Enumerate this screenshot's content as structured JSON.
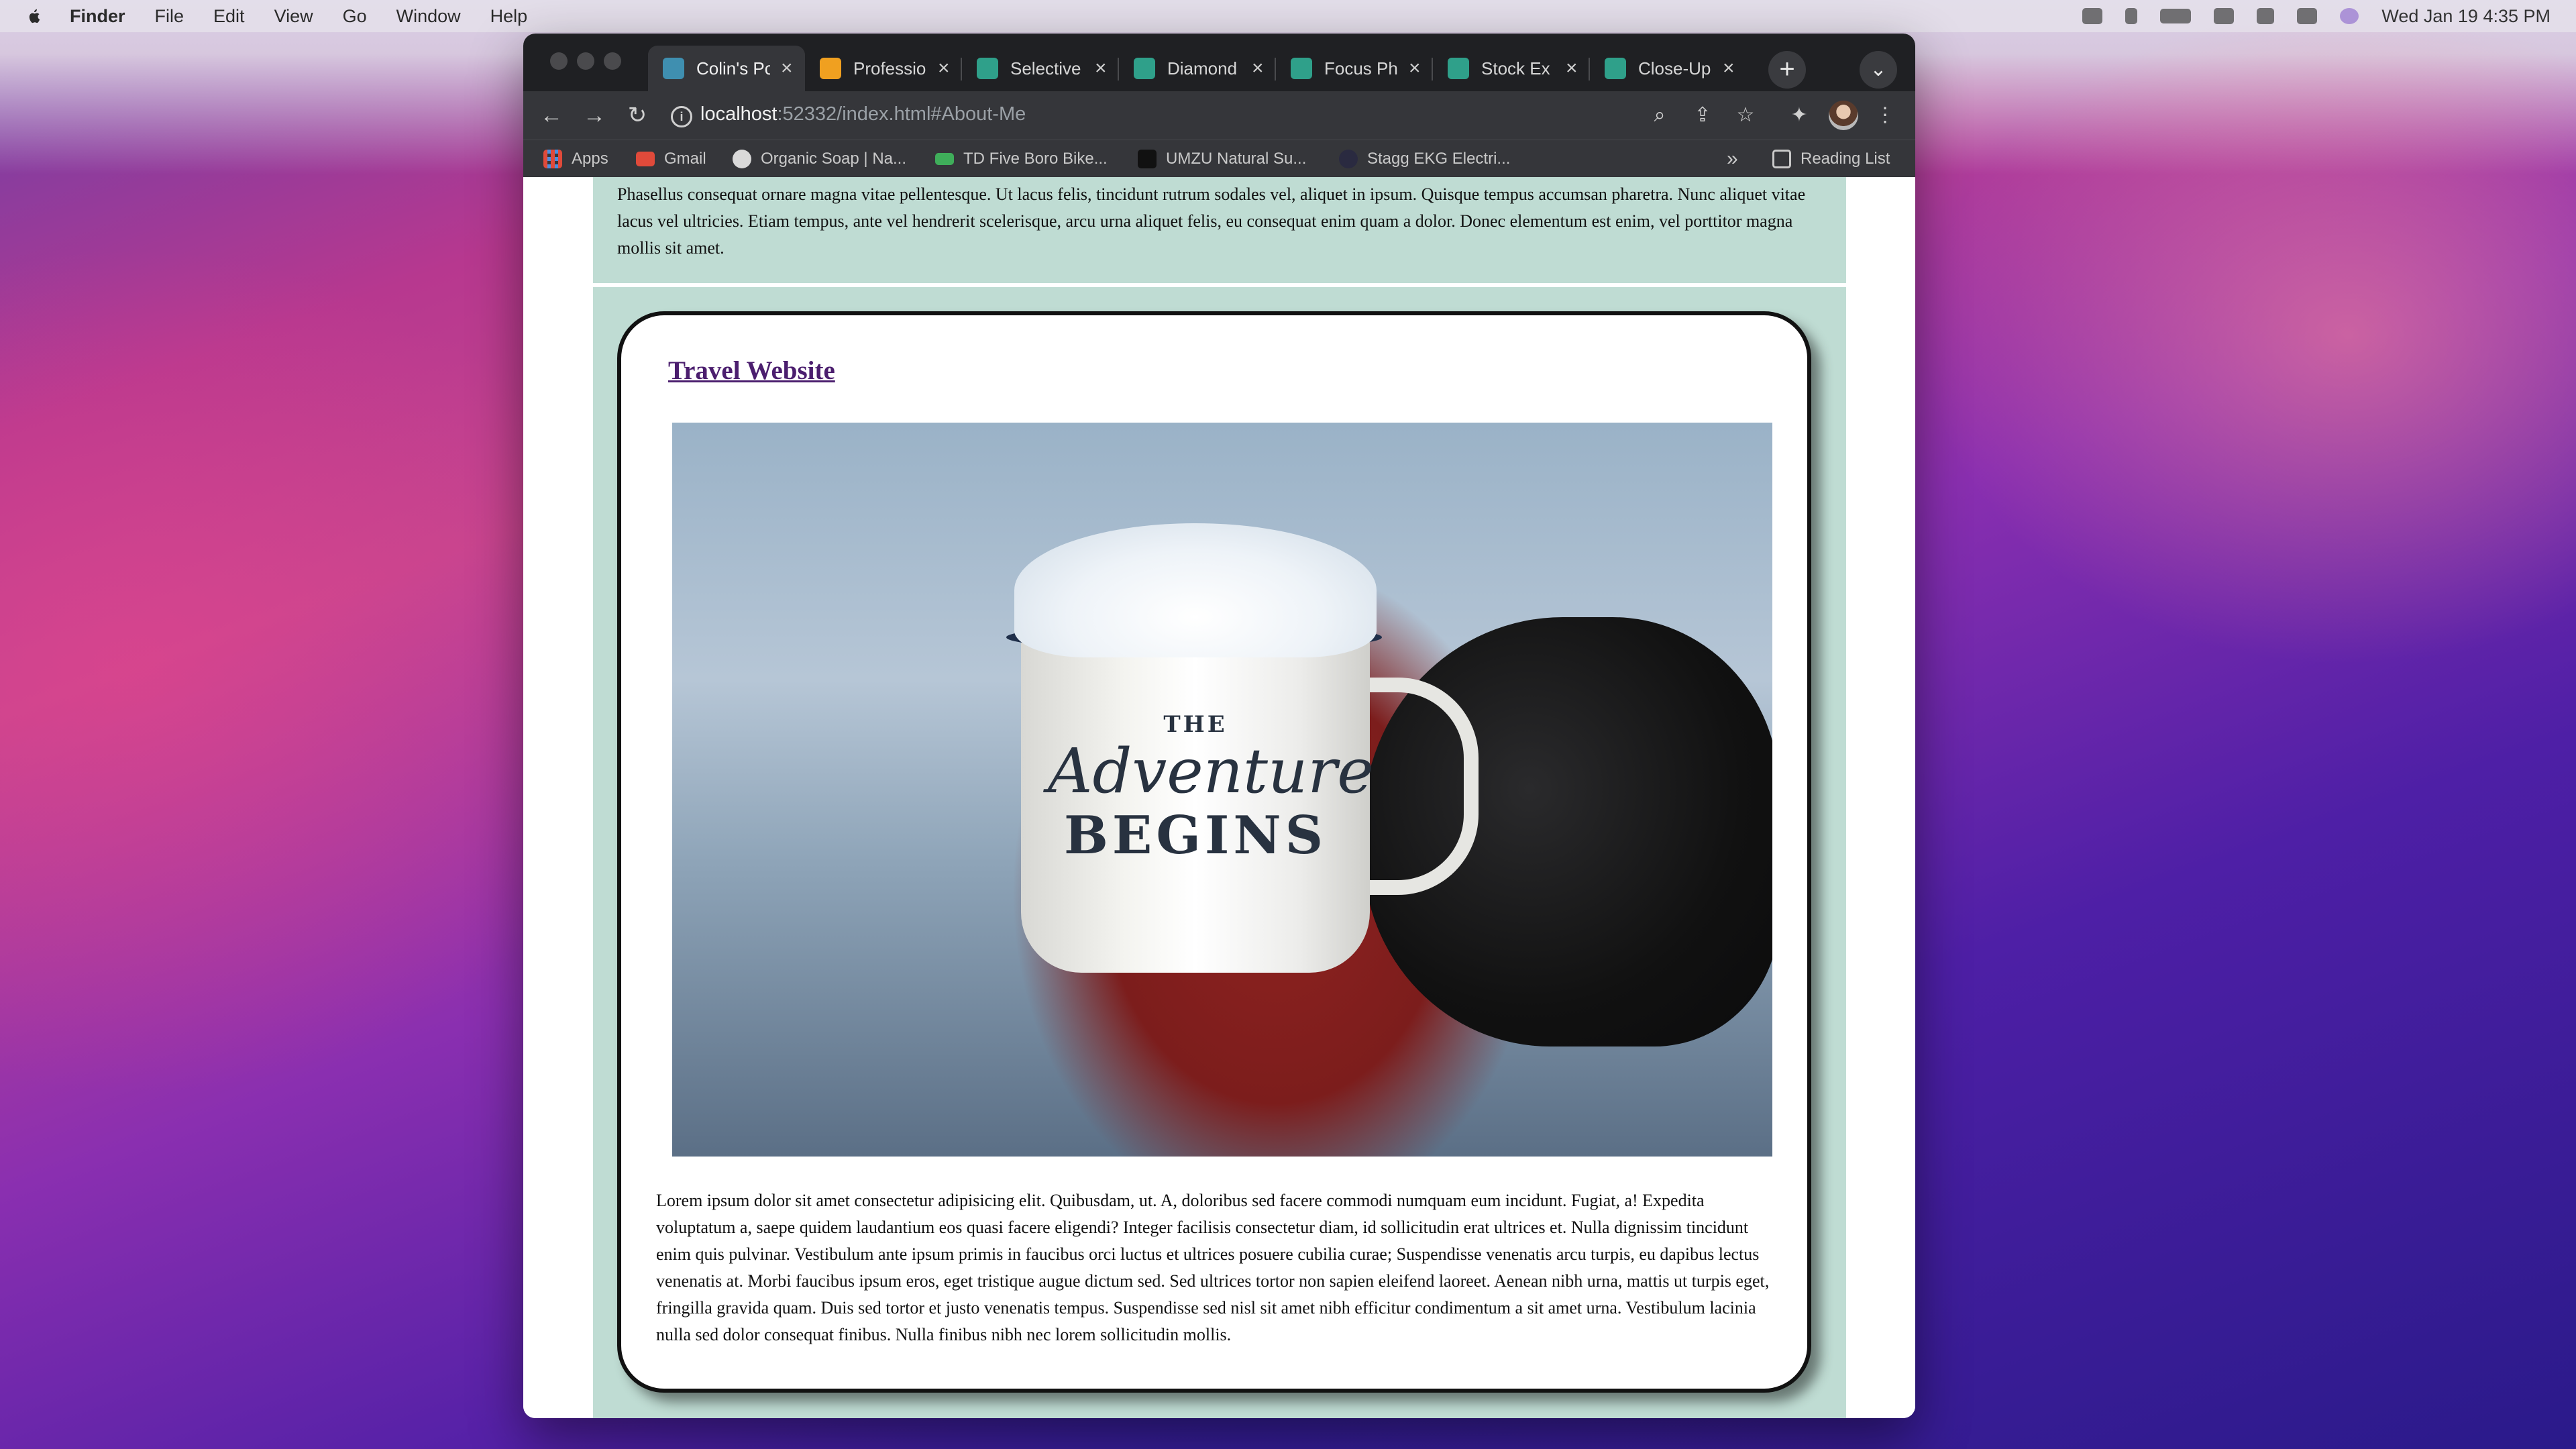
{
  "menubar": {
    "app": "Finder",
    "items": [
      "File",
      "Edit",
      "View",
      "Go",
      "Window",
      "Help"
    ],
    "clock": "Wed Jan 19  4:35 PM"
  },
  "browser": {
    "tabs": [
      {
        "label": "Colin's Pc",
        "active": true,
        "favicon_color": "#3f8fb0"
      },
      {
        "label": "Professio",
        "active": false,
        "favicon_color": "#f0a020"
      },
      {
        "label": "Selective",
        "active": false,
        "favicon_color": "#2fa08a"
      },
      {
        "label": "Diamond",
        "active": false,
        "favicon_color": "#2fa08a"
      },
      {
        "label": "Focus Ph",
        "active": false,
        "favicon_color": "#2fa08a"
      },
      {
        "label": "Stock Ex",
        "active": false,
        "favicon_color": "#2fa08a"
      },
      {
        "label": "Close-Up",
        "active": false,
        "favicon_color": "#2fa08a"
      }
    ],
    "new_tab_symbol": "+",
    "url_host": "localhost",
    "url_rest": ":52332/index.html#About-Me",
    "bookmarks": [
      {
        "label": "Apps",
        "icon": "apps-grid-icon",
        "color": "#e04a3a"
      },
      {
        "label": "Gmail",
        "icon": "gmail-icon",
        "color": "#e04a3a"
      },
      {
        "label": "Organic Soap | Na...",
        "icon": "soap-icon",
        "color": "#d9d9d9"
      },
      {
        "label": "TD Five Boro Bike...",
        "icon": "bike-icon",
        "color": "#3fae5a"
      },
      {
        "label": "UMZU Natural Su...",
        "icon": "umzu-icon",
        "color": "#111111"
      },
      {
        "label": "Stagg EKG Electri...",
        "icon": "stagg-icon",
        "color": "#2a2a40"
      }
    ],
    "bookmarks_overflow": "»",
    "reading_list": "Reading List"
  },
  "page": {
    "intro_text": "Phasellus consequat ornare magna vitae pellentesque. Ut lacus felis, tincidunt rutrum sodales vel, aliquet in ipsum. Quisque tempus accumsan pharetra. Nunc aliquet vitae lacus vel ultricies. Etiam tempus, ante vel hendrerit scelerisque, arcu urna aliquet felis, eu consequat enim quam a dolor. Donec elementum est enim, vel porttitor magna mollis sit amet.",
    "card": {
      "title": "Travel Website",
      "photo_mug_text": [
        "THE",
        "Adventure",
        "BEGINS"
      ],
      "body": "Lorem ipsum dolor sit amet consectetur adipisicing elit. Quibusdam, ut. A, doloribus sed facere commodi numquam eum incidunt. Fugiat, a! Expedita voluptatum a, saepe quidem laudantium eos quasi facere eligendi? Integer facilisis consectetur diam, id sollicitudin erat ultrices et. Nulla dignissim tincidunt enim quis pulvinar. Vestibulum ante ipsum primis in faucibus orci luctus et ultrices posuere cubilia curae; Suspendisse venenatis arcu turpis, eu dapibus lectus venenatis at. Morbi faucibus ipsum eros, eget tristique augue dictum sed. Sed ultrices tortor non sapien eleifend laoreet. Aenean nibh urna, mattis ut turpis eget, fringilla gravida quam. Duis sed tortor et justo venenatis tempus. Suspendisse sed nisl sit amet nibh efficitur condimentum a sit amet urna. Vestibulum lacinia nulla sed dolor consequat finibus. Nulla finibus nibh nec lorem sollicitudin mollis."
    }
  }
}
